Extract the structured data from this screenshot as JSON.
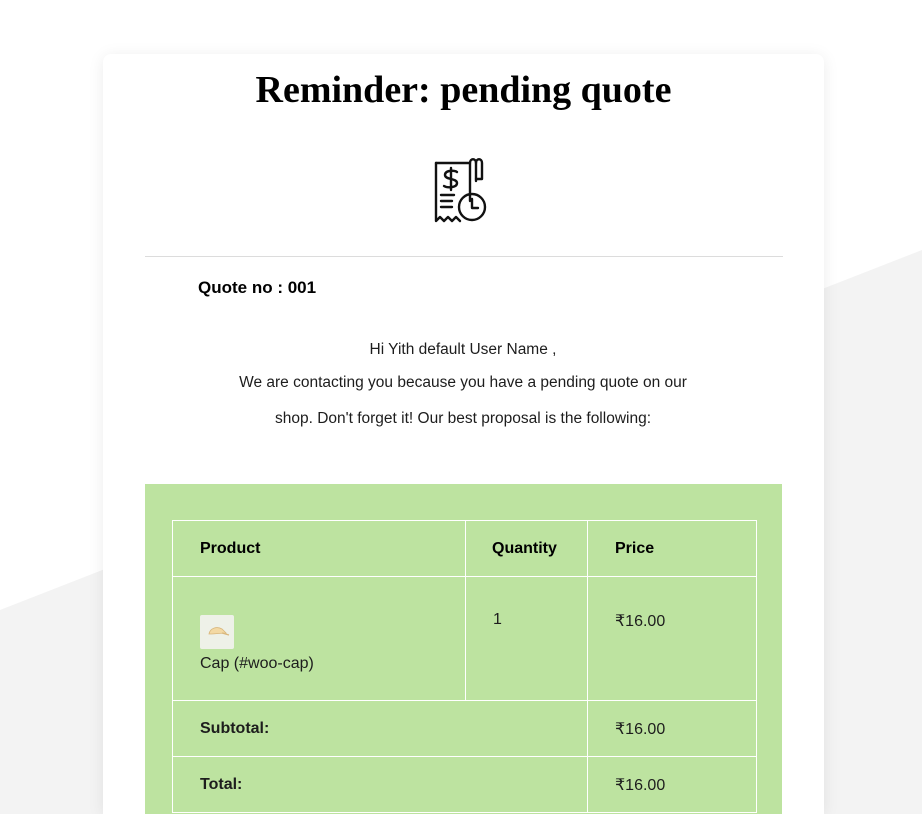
{
  "email": {
    "title": "Reminder: pending quote",
    "hero_icon": "quote-receipt-clock-icon",
    "quote_no": "Quote no : 001",
    "greeting": "Hi Yith default User Name ,",
    "message_line1": "We are contacting you because you have a pending quote on our",
    "message_line2": "shop. Don't forget it! Our best proposal is the following:"
  },
  "table": {
    "headers": {
      "product": "Product",
      "quantity": "Quantity",
      "price": "Price"
    },
    "items": [
      {
        "thumbnail_icon": "cap-thumbnail-icon",
        "name": "Cap (#woo-cap)",
        "quantity": "1",
        "price": "₹16.00"
      }
    ],
    "subtotal_label": "Subtotal:",
    "subtotal_value": "₹16.00",
    "total_label": "Total:",
    "total_value": "₹16.00"
  },
  "colors": {
    "panel_green": "#bde3a0",
    "background_gray": "#f3f3f3",
    "card_white": "#ffffff"
  }
}
